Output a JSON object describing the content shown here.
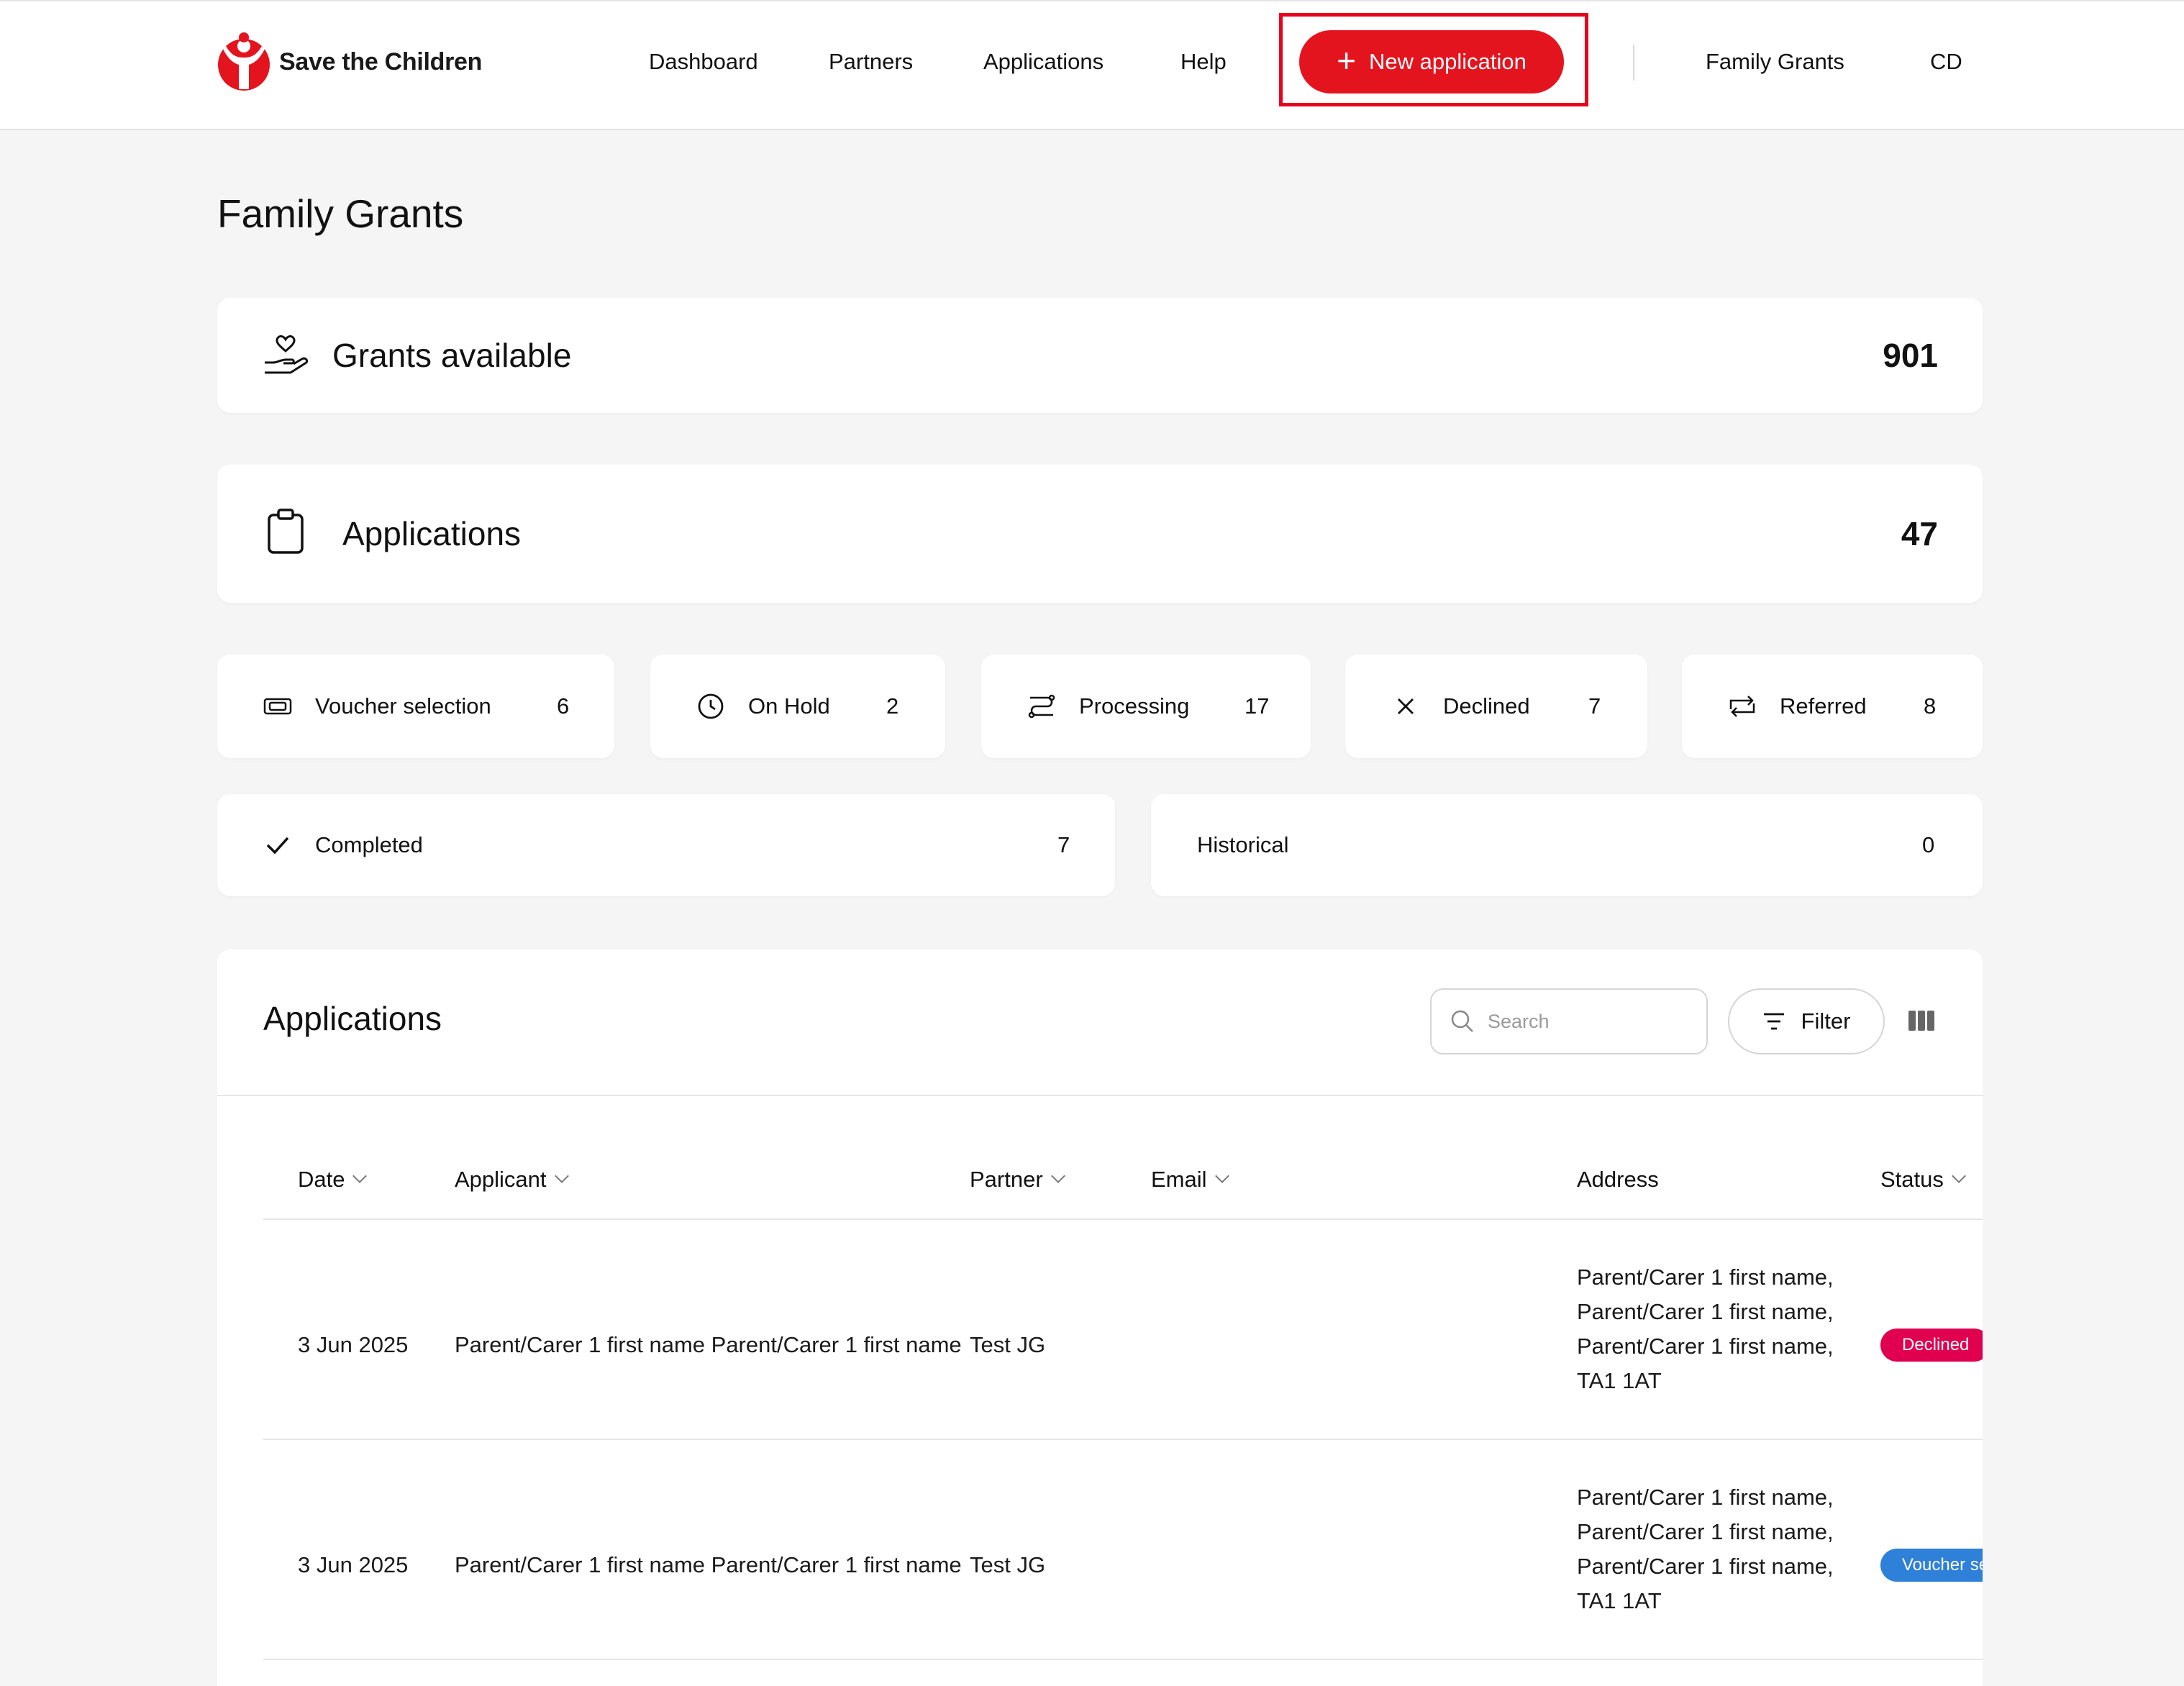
{
  "header": {
    "brand": "Save the Children",
    "nav": [
      "Dashboard",
      "Partners",
      "Applications",
      "Help"
    ],
    "new_application": "New application",
    "org": "Family Grants",
    "user_initials": "CD"
  },
  "page": {
    "title": "Family Grants"
  },
  "summary": {
    "grants_label": "Grants available",
    "grants_value": "901",
    "applications_label": "Applications",
    "applications_value": "47"
  },
  "statuses": [
    {
      "label": "Voucher selection",
      "value": "6",
      "icon": "voucher-icon"
    },
    {
      "label": "On Hold",
      "value": "2",
      "icon": "clock-icon"
    },
    {
      "label": "Processing",
      "value": "17",
      "icon": "processing-icon"
    },
    {
      "label": "Declined",
      "value": "7",
      "icon": "x-icon"
    },
    {
      "label": "Referred",
      "value": "8",
      "icon": "referred-icon"
    },
    {
      "label": "Completed",
      "value": "7",
      "icon": "check-icon"
    },
    {
      "label": "Historical",
      "value": "0",
      "icon": ""
    }
  ],
  "table": {
    "title": "Applications",
    "search_placeholder": "Search",
    "filter_label": "Filter",
    "columns": [
      "Date",
      "Applicant",
      "Partner",
      "Email",
      "Address",
      "Status"
    ],
    "rows": [
      {
        "date": "3 Jun 2025",
        "applicant": "Parent/Carer 1 first name Parent/Carer 1 first name",
        "partner": "Test JG",
        "email": "",
        "address": [
          "Parent/Carer 1 first name,",
          "Parent/Carer 1 first name,",
          "Parent/Carer 1 first name,",
          "TA1 1AT"
        ],
        "status": "Declined",
        "status_color": "#e0004f"
      },
      {
        "date": "3 Jun 2025",
        "applicant": "Parent/Carer 1 first name Parent/Carer 1 first name",
        "partner": "Test JG",
        "email": "",
        "address": [
          "Parent/Carer 1 first name,",
          "Parent/Carer 1 first name,",
          "Parent/Carer 1 first name,",
          "TA1 1AT"
        ],
        "status": "Voucher selection",
        "status_color": "#2f80d8"
      }
    ]
  },
  "colors": {
    "accent": "#e4141f",
    "background": "#f5f5f5"
  }
}
